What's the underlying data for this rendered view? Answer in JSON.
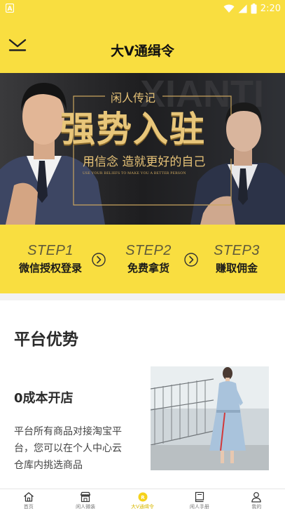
{
  "status_bar": {
    "time": "2:20"
  },
  "header": {
    "title": "大V通缉令"
  },
  "banner": {
    "subtitle": "闲人传记",
    "headline": "强势入驻",
    "slogan": "用信念 造就更好的自己",
    "slogan_en": "USE YOUR BELIEFS TO MAKE YOU A BETTER PERSON"
  },
  "steps": [
    {
      "num": "STEP1",
      "label": "微信授权登录"
    },
    {
      "num": "STEP2",
      "label": "免费拿货"
    },
    {
      "num": "STEP3",
      "label": "赚取佣金"
    }
  ],
  "advantages": {
    "title": "平台优势",
    "feature_title": "0成本开店",
    "feature_desc": "平台所有商品对接淘宝平台，您可以在个人中心云仓库内挑选商品"
  },
  "bottom_nav": [
    {
      "label": "首页",
      "icon": "home-icon"
    },
    {
      "label": "闲人微装",
      "icon": "store-icon"
    },
    {
      "label": "大V通缉令",
      "icon": "badge-icon",
      "active": true
    },
    {
      "label": "闲人手册",
      "icon": "book-icon"
    },
    {
      "label": "我的",
      "icon": "user-icon"
    }
  ],
  "colors": {
    "accent": "#f9de40",
    "active_nav": "#d8b800",
    "banner_gold": "#e6c277"
  }
}
